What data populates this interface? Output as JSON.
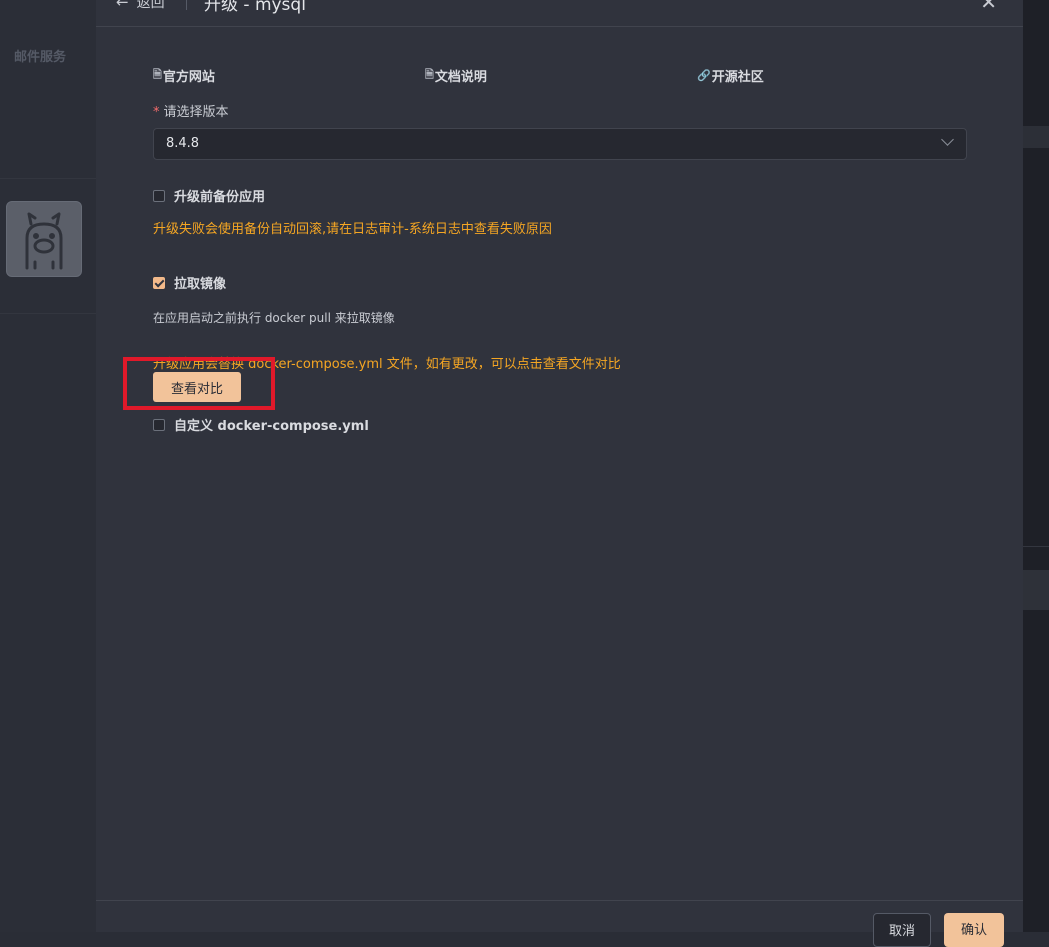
{
  "background": {
    "sidebar_label": "邮件服务",
    "app_icon": "llama-icon"
  },
  "header": {
    "back_icon": "arrow-left-icon",
    "back_label": "返回",
    "title": "升级 - mysql",
    "close_icon": "close-icon"
  },
  "links": [
    {
      "icon": "document-icon",
      "label": "官方网站"
    },
    {
      "icon": "document-icon",
      "label": "文档说明"
    },
    {
      "icon": "link-icon",
      "label": "开源社区"
    }
  ],
  "form": {
    "version_label": "请选择版本",
    "required_mark": "*",
    "version_value": "8.4.8",
    "backup": {
      "label": "升级前备份应用",
      "checked": false
    },
    "backup_warning": "升级失败会使用备份自动回滚,请在日志审计-系统日志中查看失败原因",
    "pull_image": {
      "label": "拉取镜像",
      "checked": true
    },
    "pull_hint": "在应用启动之前执行 docker pull 来拉取镜像",
    "compose_warning": "升级应用会替换 docker-compose.yml 文件，如有更改，可以点击查看文件对比",
    "diff_button": "查看对比",
    "custom_compose": {
      "label": "自定义 docker-compose.yml",
      "checked": false
    }
  },
  "footer": {
    "cancel_label": "取消",
    "confirm_label": "确认"
  },
  "colors": {
    "accent": "#f2c39a",
    "warning": "#f5a623",
    "highlight_box": "#e0192a"
  }
}
